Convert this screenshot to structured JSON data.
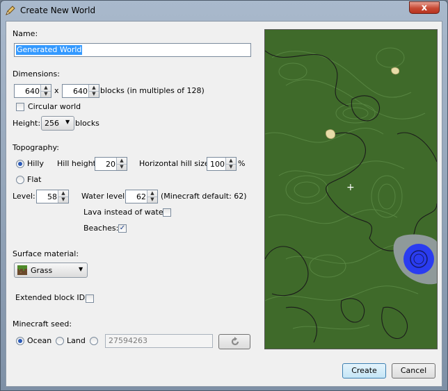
{
  "window": {
    "title": "Create New World",
    "close_label": "x"
  },
  "name": {
    "label": "Name:",
    "value": "Generated World"
  },
  "dimensions": {
    "label": "Dimensions:",
    "width": "640",
    "x_label": "x",
    "height_val": "640",
    "units_label": "blocks (in multiples of 128)",
    "circular_label": "Circular world",
    "circular_checked": false
  },
  "height": {
    "label": "Height:",
    "value": "256",
    "units": "blocks"
  },
  "topography": {
    "label": "Topography:",
    "hilly_label": "Hilly",
    "flat_label": "Flat",
    "selected": "hilly",
    "hill_height_label": "Hill height:",
    "hill_height": "20",
    "hill_size_label": "Horizontal hill size:",
    "hill_size": "100",
    "percent": "%",
    "level_label": "Level:",
    "level": "58",
    "water_level_label": "Water level:",
    "water_level": "62",
    "water_default_note": "(Minecraft default: 62)",
    "lava_label": "Lava instead of water:",
    "lava_checked": false,
    "beaches_label": "Beaches:",
    "beaches_checked": true,
    "check_mark": "✓"
  },
  "surface": {
    "label": "Surface material:",
    "value": "Grass"
  },
  "extended": {
    "label": "Extended block IDs:",
    "checked": false
  },
  "seed": {
    "label": "Minecraft seed:",
    "ocean_label": "Ocean",
    "land_label": "Land",
    "selected": "ocean",
    "value": "27594263",
    "refresh_icon": "refresh-icon"
  },
  "map": {
    "cursor": "+"
  },
  "buttons": {
    "create": "Create",
    "cancel": "Cancel"
  },
  "colors": {
    "accent": "#2a5ab8",
    "grass": "#3f6a2a",
    "water": "#2a3cf0",
    "selection": "#3399ff"
  }
}
